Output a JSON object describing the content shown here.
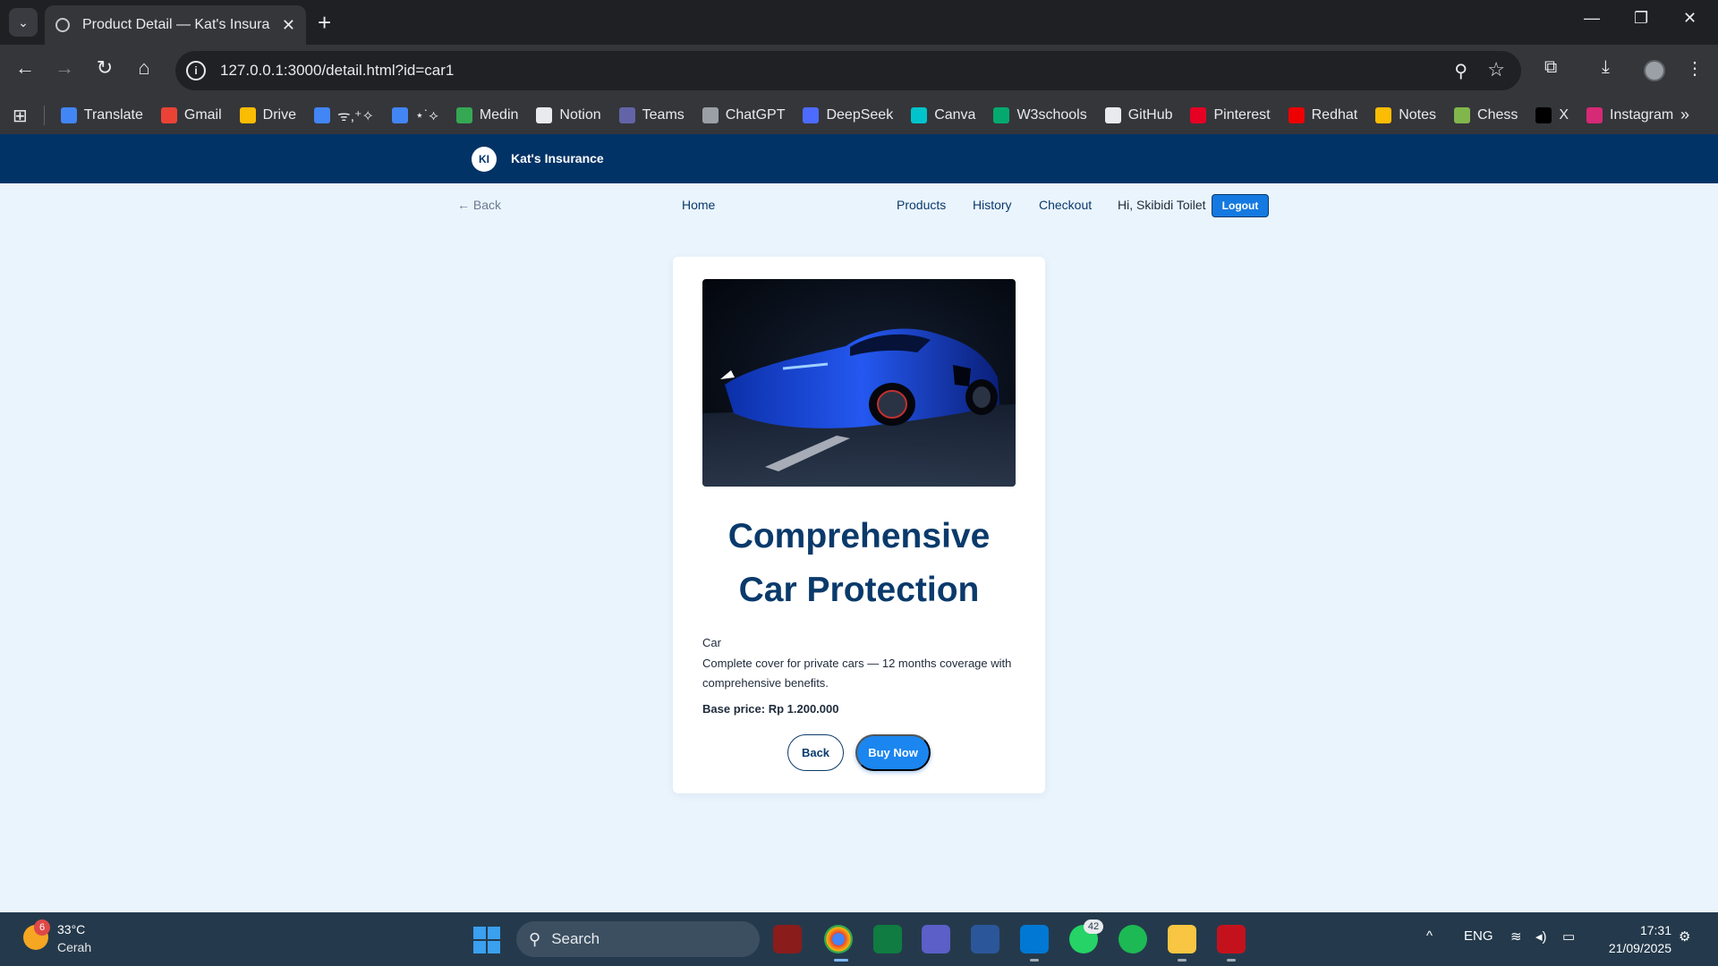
{
  "browser": {
    "tab_title": "Product Detail — Kat's Insuranc",
    "url": "127.0.0.1:3000/detail.html?id=car1",
    "bookmarks": [
      {
        "label": "Translate",
        "color": "#4285f4"
      },
      {
        "label": "Gmail",
        "color": "#ea4335"
      },
      {
        "label": "Drive",
        "color": "#fbbc04"
      },
      {
        "label": "ᯤ,⁺✧",
        "color": "#4285f4"
      },
      {
        "label": "⋆˙⟡",
        "color": "#4285f4"
      },
      {
        "label": "Medin",
        "color": "#34a853"
      },
      {
        "label": "Notion",
        "color": "#e8eaed"
      },
      {
        "label": "Teams",
        "color": "#6264a7"
      },
      {
        "label": "ChatGPT",
        "color": "#9aa0a6"
      },
      {
        "label": "DeepSeek",
        "color": "#4d6bfe"
      },
      {
        "label": "Canva",
        "color": "#00c4cc"
      },
      {
        "label": "W3schools",
        "color": "#04aa6d"
      },
      {
        "label": "GitHub",
        "color": "#e8eaed"
      },
      {
        "label": "Pinterest",
        "color": "#e60023"
      },
      {
        "label": "Redhat",
        "color": "#ee0000"
      },
      {
        "label": "Notes",
        "color": "#fbbc04"
      },
      {
        "label": "Chess",
        "color": "#81b64c"
      },
      {
        "label": "X",
        "color": "#000000"
      },
      {
        "label": "Instagram",
        "color": "#d62976"
      }
    ]
  },
  "site": {
    "logo_initials": "KI",
    "brand": "Kat's Insurance",
    "back_link": "← Back",
    "nav": {
      "home": "Home",
      "products": "Products",
      "history": "History",
      "checkout": "Checkout"
    },
    "greeting": "Hi, Skibidi Toilet",
    "logout": "Logout"
  },
  "product": {
    "title_line1": "Comprehensive",
    "title_line2": "Car Protection",
    "category": "Car",
    "description": "Complete cover for private cars — 12 months coverage with comprehensive benefits.",
    "price": "Base price: Rp 1.200.000",
    "back_button": "Back",
    "buy_button": "Buy Now"
  },
  "taskbar": {
    "temperature": "33°C",
    "condition": "Cerah",
    "weather_badge": "6",
    "search_placeholder": "Search",
    "whatsapp_badge": "42",
    "language": "ENG",
    "time": "17:31",
    "date": "21/09/2025"
  },
  "colors": {
    "header_bg": "#023366",
    "page_bg": "#eaf4fd",
    "accent": "#1b86ef",
    "title": "#0a3a6b"
  }
}
